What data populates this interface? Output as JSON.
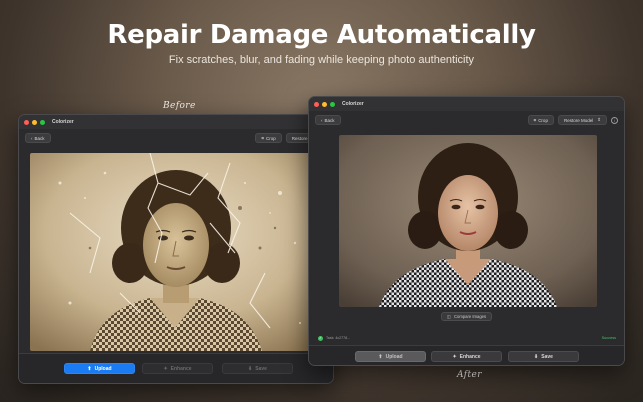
{
  "hero": {
    "title": "Repair Damage Automatically",
    "subtitle": "Fix scratches, blur, and fading while keeping photo authenticity",
    "before_label": "Before",
    "after_label": "After"
  },
  "before_window": {
    "title": "Colorizer",
    "back_label": "Back",
    "crop_label": "Crop",
    "model_label": "Restore Model",
    "buttons": {
      "upload": "Upload",
      "enhance": "Enhance",
      "save": "Save"
    }
  },
  "after_window": {
    "title": "Colorizer",
    "back_label": "Back",
    "crop_label": "Crop",
    "model_label": "Restore Model",
    "compare_label": "Compare Images",
    "status_text": "Task: 4c2778...",
    "status_result": "Success",
    "buttons": {
      "upload": "Upload",
      "enhance": "Enhance",
      "save": "Save"
    }
  },
  "icons": {
    "back": "chevron-left-icon",
    "crop": "crop-icon",
    "model_select": "chevron-updown-icon",
    "info": "info-icon",
    "upload": "upload-icon",
    "enhance": "magic-wand-icon",
    "save": "save-icon",
    "compare": "compare-icon"
  },
  "colors": {
    "accent": "#1a7bf2",
    "success": "#44c466",
    "traffic_red": "#ff5f57",
    "traffic_yellow": "#febc2e",
    "traffic_green": "#28c840"
  }
}
